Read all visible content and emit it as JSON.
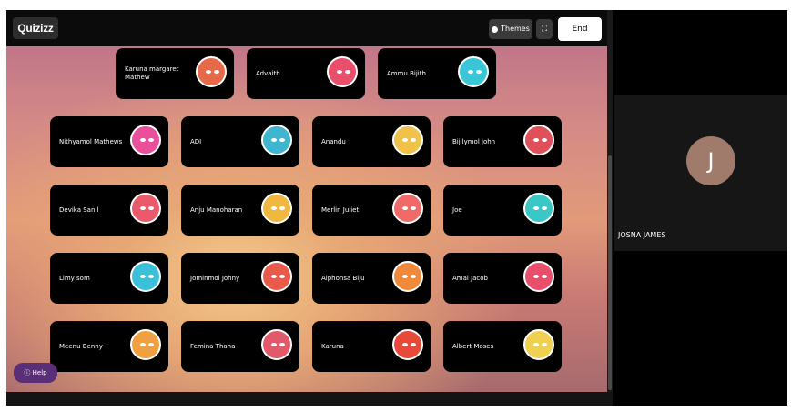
{
  "toolbar": {
    "logo": "Quizizz",
    "themes_label": "Themes",
    "fullscreen_icon": "expand-icon",
    "end_label": "End"
  },
  "players": [
    {
      "name": "Karuna margaret Mathew",
      "color": "#e66a4a"
    },
    {
      "name": "Advaith",
      "color": "#e94f6b"
    },
    {
      "name": "Ammu Bijith",
      "color": "#39c6d6"
    },
    {
      "name": "Nithyamol Mathews",
      "color": "#e94f9a"
    },
    {
      "name": "ADI",
      "color": "#3fb5d0"
    },
    {
      "name": "Anandu",
      "color": "#f0c24a"
    },
    {
      "name": "Bijilymol john",
      "color": "#e0505a"
    },
    {
      "name": "Devika Sanil",
      "color": "#ea5a6a"
    },
    {
      "name": "Anju Manoharan",
      "color": "#f0b840"
    },
    {
      "name": "Merlin Juliet",
      "color": "#f06a6a"
    },
    {
      "name": "Joe",
      "color": "#3cc7c7"
    },
    {
      "name": "Limy som",
      "color": "#3ac0d8"
    },
    {
      "name": "Jominmol Johny",
      "color": "#e95a4a"
    },
    {
      "name": "Alphonsa Biju",
      "color": "#f08a3a"
    },
    {
      "name": "Amal Jacob",
      "color": "#e94f6b"
    },
    {
      "name": "Meenu Benny",
      "color": "#f0a040"
    },
    {
      "name": "Femina Thaha",
      "color": "#e25a6a"
    },
    {
      "name": "Karuna",
      "color": "#e84a3a"
    },
    {
      "name": "Albert Moses",
      "color": "#f0d050"
    }
  ],
  "help": {
    "label": "Help"
  },
  "participant": {
    "initial": "J",
    "name": "JOSNA JAMES",
    "avatar_color": "#a07a6a"
  }
}
